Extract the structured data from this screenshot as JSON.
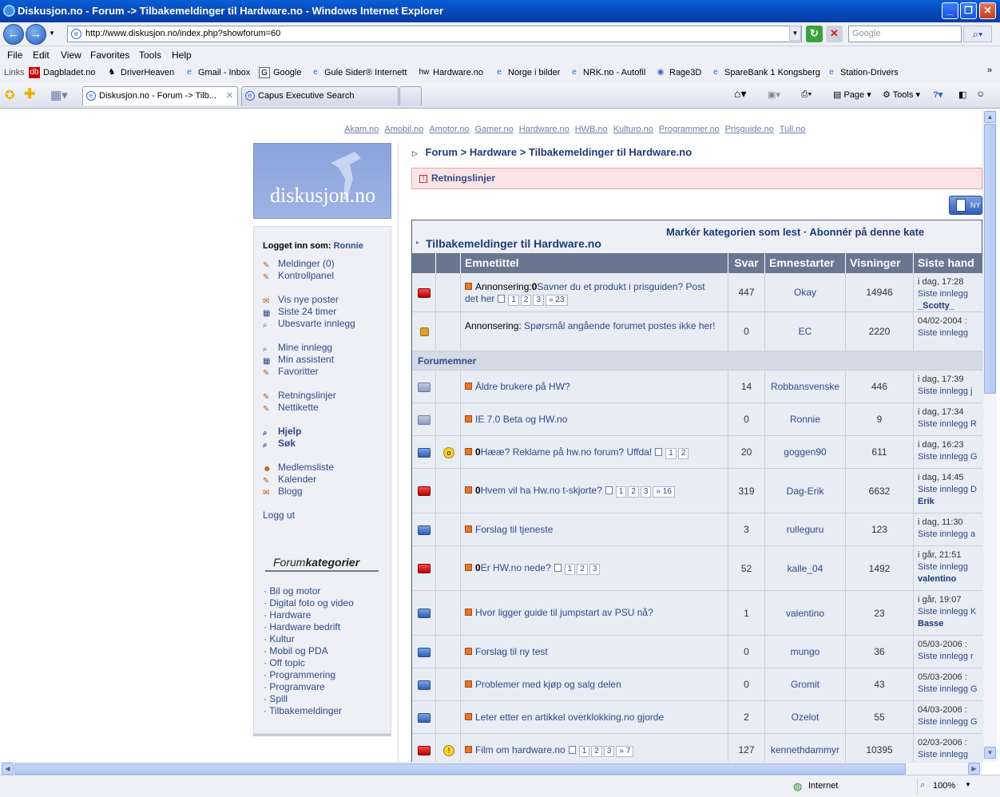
{
  "window": {
    "title": "Diskusjon.no - Forum -> Tilbakemeldinger til Hardware.no - Windows Internet Explorer"
  },
  "address": {
    "url": "http://www.diskusjon.no/index.php?showforum=60",
    "search_placeholder": "Google"
  },
  "menu": [
    "File",
    "Edit",
    "View",
    "Favorites",
    "Tools",
    "Help"
  ],
  "links": {
    "label": "Links",
    "items": [
      "Dagbladet.no",
      "DriverHeaven",
      "Gmail - Inbox",
      "Google",
      "Gule Sider® Internett",
      "Hardware.no",
      "Norge i bilder",
      "NRK.no - Autofil",
      "Rage3D",
      "SpareBank 1 Kongsberg",
      "Station-Drivers"
    ]
  },
  "tabs": [
    {
      "label": "Diskusjon.no - Forum -> Tilb...",
      "active": true
    },
    {
      "label": "Capus Executive Search",
      "active": false
    }
  ],
  "toolbar": {
    "page": "Page",
    "tools": "Tools"
  },
  "status": {
    "zone": "Internet",
    "zoom": "100%"
  },
  "network": [
    "Akam.no",
    "Amobil.no",
    "Amotor.no",
    "Gamer.no",
    "Hardware.no",
    "HWB.no",
    "Kulturo.no",
    "Programmer.no",
    "Prisguide.no",
    "Tull.no"
  ],
  "site": {
    "logo": "diskusjon.no"
  },
  "sidebar": {
    "logged_in_label": "Logget inn som:",
    "user": "Ronnie",
    "group1": [
      "Meldinger (0)",
      "Kontrollpanel"
    ],
    "group2": [
      "Vis nye poster",
      "Siste 24 timer",
      "Ubesvarte innlegg"
    ],
    "group3": [
      "Mine innlegg",
      "Min assistent",
      "Favoritter"
    ],
    "group4": [
      "Retningslinjer",
      "Nettikette"
    ],
    "group5": [
      "Hjelp",
      "Søk"
    ],
    "group6": [
      "Medlemsliste",
      "Kalender",
      "Blogg"
    ],
    "logout": "Logg ut",
    "cat_title_a": "Forum",
    "cat_title_b": "kategorier",
    "categories": [
      "Bil og motor",
      "Digital foto og video",
      "Hardware",
      "Hardware bedrift",
      "Kultur",
      "Mobil og PDA",
      "Off topic",
      "Programmering",
      "Programvare",
      "Spill",
      "Tilbakemeldinger"
    ]
  },
  "breadcrumb": {
    "root": "Forum",
    "sep": ">",
    "mid": "Hardware",
    "leaf": "Tilbakemeldinger til Hardware.no"
  },
  "rules_label": "Retningslinjer",
  "new_button": "NY",
  "forum": {
    "actions": "Markér kategorien som lest · Abonnér på denne kate",
    "name": "Tilbakemeldinger til Hardware.no",
    "columns": [
      "Emnetittel",
      "Svar",
      "Emnestarter",
      "Visninger",
      "Siste hand"
    ],
    "section_label": "Forumemner",
    "announcements": [
      {
        "prefix": "Annonsering:",
        "title": "Savner du et produkt i prisguiden? Post det her",
        "pages": [
          "1",
          "2",
          "3",
          "» 23"
        ],
        "replies": "447",
        "starter": "Okay",
        "views": "14946",
        "last_date": "i dag, 17:28",
        "last_label": "Siste innlegg",
        "last_user": "_Scotty_",
        "folder": "red"
      },
      {
        "prefix": "Annonsering:",
        "title": "Spørsmål angående forumet postes ikke her!",
        "pages": [],
        "replies": "0",
        "starter": "EC",
        "views": "2220",
        "last_date": "04/02-2004 :",
        "last_label": "Siste innlegg",
        "last_user": "",
        "folder": "lock"
      }
    ],
    "topics": [
      {
        "title": "Äldre brukere på HW?",
        "pages": [],
        "replies": "14",
        "starter": "Robbansvenske",
        "views": "446",
        "last_date": "i dag, 17:39",
        "last_label": "Siste innlegg j",
        "last_user": "",
        "folder": "grey",
        "pinned": false
      },
      {
        "title": "IE 7.0 Beta og HW.no",
        "pages": [],
        "replies": "0",
        "starter": "Ronnie",
        "views": "9",
        "last_date": "i dag, 17:34",
        "last_label": "Siste innlegg R",
        "last_user": "",
        "folder": "grey",
        "pinned": false
      },
      {
        "title": "Hææ? Reklame på hw.no forum? Uffda!",
        "pages": [
          "1",
          "2"
        ],
        "replies": "20",
        "starter": "goggen90",
        "views": "611",
        "last_date": "i dag, 16:23",
        "last_label": "Siste innlegg G",
        "last_user": "",
        "folder": "blue",
        "pinned": true,
        "emo": "shock"
      },
      {
        "title": "Hvem vil ha Hw.no t-skjorte?",
        "pages": [
          "1",
          "2",
          "3",
          "» 16"
        ],
        "replies": "319",
        "starter": "Dag-Erik",
        "views": "6632",
        "last_date": "i dag, 14:45",
        "last_label": "Siste innlegg D",
        "last_user": "Erik",
        "folder": "red",
        "pinned": true
      },
      {
        "title": "Forslag til tjeneste",
        "pages": [],
        "replies": "3",
        "starter": "rulleguru",
        "views": "123",
        "last_date": "i dag, 11:30",
        "last_label": "Siste innlegg a",
        "last_user": "",
        "folder": "blue",
        "pinned": false
      },
      {
        "title": "Er HW.no nede?",
        "pages": [
          "1",
          "2",
          "3"
        ],
        "replies": "52",
        "starter": "kalle_04",
        "views": "1492",
        "last_date": "i går, 21:51",
        "last_label": "Siste innlegg",
        "last_user": "valentino",
        "folder": "red",
        "pinned": true
      },
      {
        "title": "Hvor ligger guide til jumpstart av PSU nå?",
        "pages": [],
        "replies": "1",
        "starter": "valentino",
        "views": "23",
        "last_date": "i går, 19:07",
        "last_label": "Siste innlegg K",
        "last_user": "Basse",
        "folder": "blue",
        "pinned": false
      },
      {
        "title": "Forslag til ny test",
        "pages": [],
        "replies": "0",
        "starter": "mungo",
        "views": "36",
        "last_date": "05/03-2006 :",
        "last_label": "Siste innlegg r",
        "last_user": "",
        "folder": "blue",
        "pinned": false
      },
      {
        "title": "Problemer med kjøp og salg delen",
        "pages": [],
        "replies": "0",
        "starter": "Gromit",
        "views": "43",
        "last_date": "05/03-2006 :",
        "last_label": "Siste innlegg G",
        "last_user": "",
        "folder": "blue",
        "pinned": false
      },
      {
        "title": "Leter etter en artikkel overklokking.no gjorde",
        "pages": [],
        "replies": "2",
        "starter": "Ozelot",
        "views": "55",
        "last_date": "04/03-2006 :",
        "last_label": "Siste innlegg G",
        "last_user": "",
        "folder": "blue",
        "pinned": false
      },
      {
        "title": "Film om hardware.no",
        "pages": [
          "1",
          "2",
          "3",
          "» 7"
        ],
        "replies": "127",
        "starter": "kennethdammyr",
        "views": "10395",
        "last_date": "02/03-2006 :",
        "last_label": "Siste innlegg",
        "last_user": "",
        "folder": "red",
        "pinned": false,
        "emo": "warn"
      }
    ]
  }
}
